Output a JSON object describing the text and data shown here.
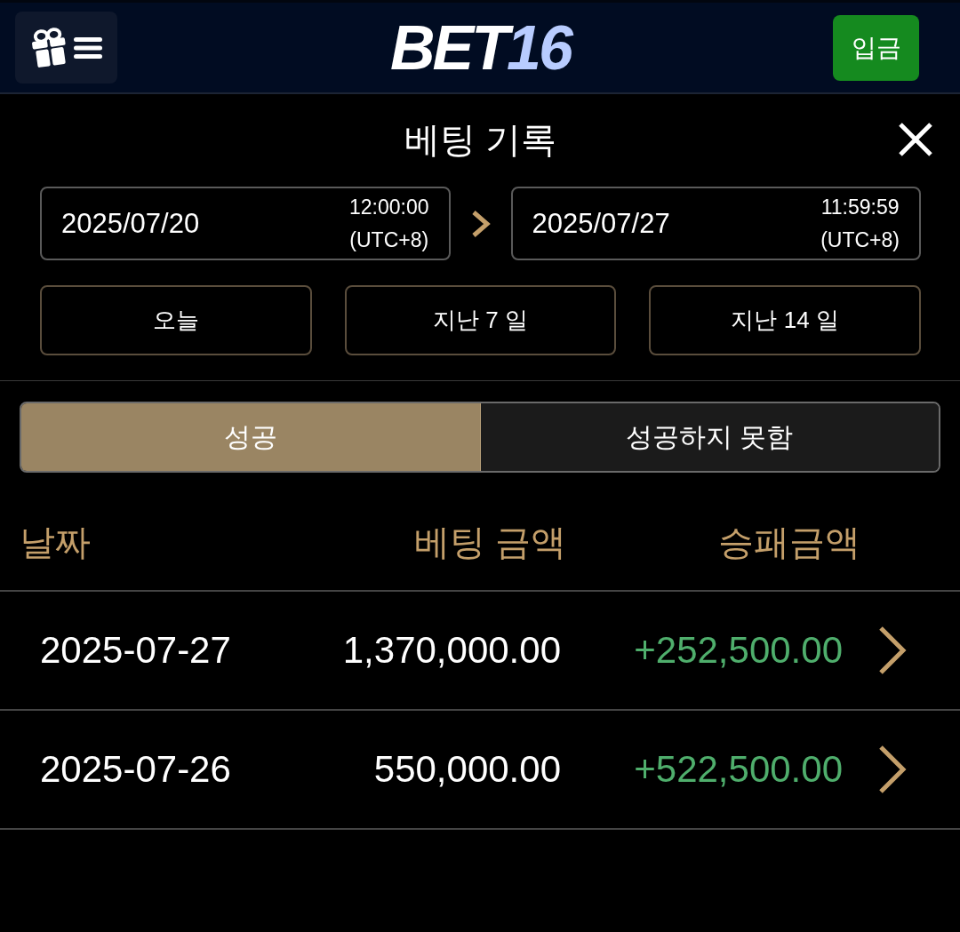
{
  "header": {
    "logo": {
      "text": "BET",
      "accent": "16"
    },
    "deposit_button": "입금"
  },
  "title": "베팅 기록",
  "date_range": {
    "start": {
      "date": "2025/07/20",
      "time": "12:00:00",
      "timezone": "(UTC+8)"
    },
    "end": {
      "date": "2025/07/27",
      "time": "11:59:59",
      "timezone": "(UTC+8)"
    }
  },
  "quick_ranges": [
    "오늘",
    "지난 7 일",
    "지난 14 일"
  ],
  "tabs": [
    {
      "label": "성공",
      "selected": true
    },
    {
      "label": "성공하지 못함",
      "selected": false
    }
  ],
  "table": {
    "columns": [
      "날짜",
      "베팅 금액",
      "승패금액"
    ],
    "rows": [
      {
        "date": "2025-07-27",
        "bet_amount": "1,370,000.00",
        "win_loss": "+252,500.00"
      },
      {
        "date": "2025-07-26",
        "bet_amount": "550,000.00",
        "win_loss": "+522,500.00"
      }
    ]
  }
}
